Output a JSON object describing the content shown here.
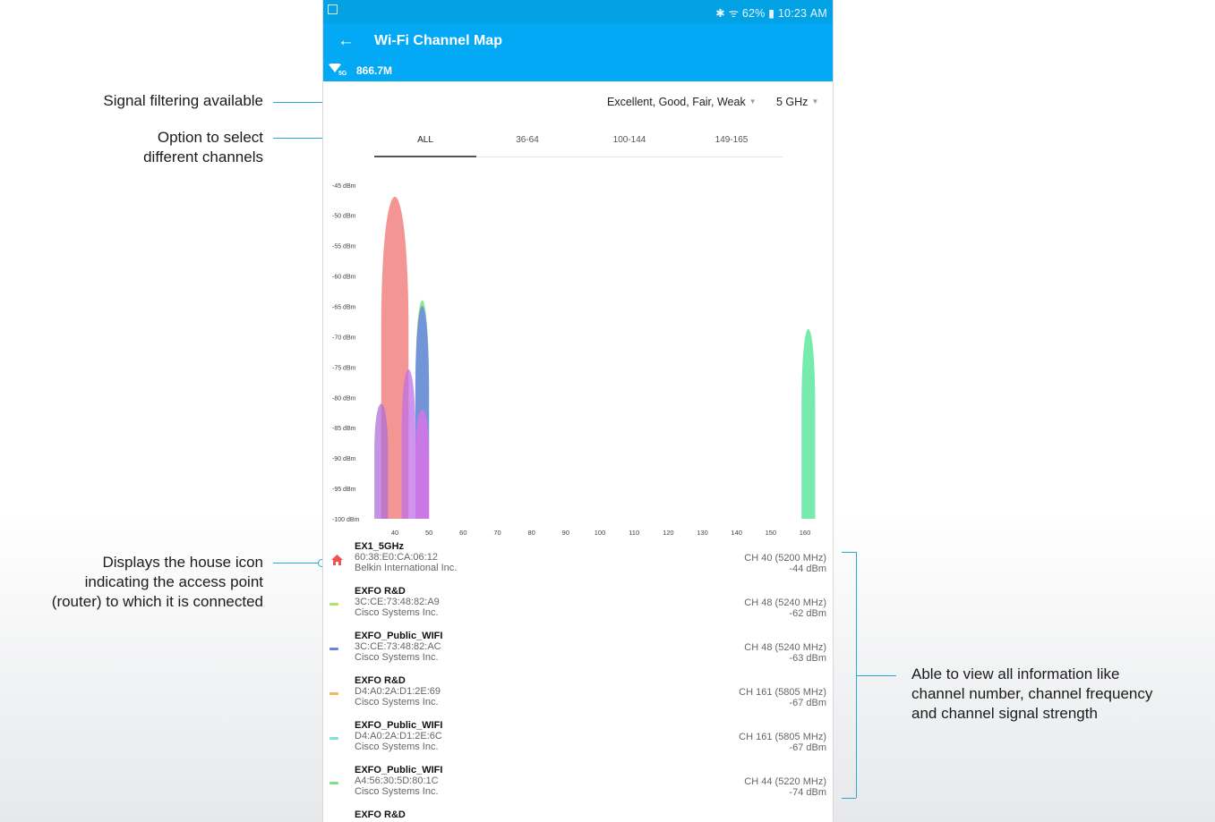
{
  "status_bar": {
    "right_text": "✱ ᯤ 62% ▮ 10:23 AM"
  },
  "app_bar": {
    "back_icon": "arrow-left-icon",
    "title": "Wi-Fi Channel Map"
  },
  "connection": {
    "band_badge": "5G",
    "speed": "866.7M"
  },
  "filters": {
    "signal": "Excellent, Good, Fair, Weak",
    "band": "5 GHz"
  },
  "tabs": [
    "ALL",
    "36-64",
    "100-144",
    "149-165"
  ],
  "active_tab": "ALL",
  "annotations": {
    "signal_filter": "Signal filtering available",
    "channel_select_1": "Option to select",
    "channel_select_2": "different channels",
    "house_1": "Displays the house icon",
    "house_2": "indicating the access point",
    "house_3": "(router) to which it is connected",
    "info_1": "Able to view all information like",
    "info_2": "channel number, channel frequency",
    "info_3": "and channel signal strength"
  },
  "chart_data": {
    "type": "area",
    "y_ticks": [
      "-45 dBm",
      "-50 dBm",
      "-55 dBm",
      "-60 dBm",
      "-65 dBm",
      "-70 dBm",
      "-75 dBm",
      "-80 dBm",
      "-85 dBm",
      "-90 dBm",
      "-95 dBm",
      "-100 dBm"
    ],
    "x_ticks": [
      "40",
      "50",
      "60",
      "70",
      "80",
      "90",
      "100",
      "110",
      "120",
      "130",
      "140",
      "150",
      "160"
    ],
    "ylim": [
      -100,
      -44
    ],
    "xlim": [
      33,
      165
    ],
    "grid": false,
    "series": [
      {
        "channel": 40,
        "peak_dbm": -44,
        "width_ch": 8,
        "color": "#f07a78",
        "opacity": 0.8
      },
      {
        "channel": 36,
        "peak_dbm": -80,
        "width_ch": 4,
        "color": "#b06fd8",
        "opacity": 0.75
      },
      {
        "channel": 48,
        "peak_dbm": -62,
        "width_ch": 4,
        "color": "#6fdc6f",
        "opacity": 0.75
      },
      {
        "channel": 48,
        "peak_dbm": -63,
        "width_ch": 4,
        "color": "#6f86e6",
        "opacity": 0.85
      },
      {
        "channel": 44,
        "peak_dbm": -74,
        "width_ch": 4,
        "color": "#c070e8",
        "opacity": 0.75
      },
      {
        "channel": 48,
        "peak_dbm": -81,
        "width_ch": 4,
        "color": "#e070e8",
        "opacity": 0.8
      },
      {
        "channel": 161,
        "peak_dbm": -67,
        "width_ch": 4,
        "color": "#5fe6a0",
        "opacity": 0.85
      }
    ]
  },
  "access_points": [
    {
      "name": "EX1_5GHz",
      "mac": "60:38:E0:CA:06:12",
      "vendor": "Belkin International Inc.",
      "channel": "CH 40 (5200 MHz)",
      "signal": "-44 dBm",
      "marker": "house-icon",
      "color": "#ef5350"
    },
    {
      "name": "EXFO R&D",
      "mac": "3C:CE:73:48:82:A9",
      "vendor": "Cisco Systems Inc.",
      "channel": "CH 48 (5240 MHz)",
      "signal": "-62 dBm",
      "marker": "swatch",
      "color": "#b2e06a"
    },
    {
      "name": "EXFO_Public_WIFI",
      "mac": "3C:CE:73:48:82:AC",
      "vendor": "Cisco Systems Inc.",
      "channel": "CH 48 (5240 MHz)",
      "signal": "-63 dBm",
      "marker": "swatch",
      "color": "#6f7fe8"
    },
    {
      "name": "EXFO R&D",
      "mac": "D4:A0:2A:D1:2E:69",
      "vendor": "Cisco Systems Inc.",
      "channel": "CH 161 (5805 MHz)",
      "signal": "-67 dBm",
      "marker": "swatch",
      "color": "#f2b65c"
    },
    {
      "name": "EXFO_Public_WIFI",
      "mac": "D4:A0:2A:D1:2E:6C",
      "vendor": "Cisco Systems Inc.",
      "channel": "CH 161 (5805 MHz)",
      "signal": "-67 dBm",
      "marker": "swatch",
      "color": "#7fe3d8"
    },
    {
      "name": "EXFO_Public_WIFI",
      "mac": "A4:56:30:5D:80:1C",
      "vendor": "Cisco Systems Inc.",
      "channel": "CH 44 (5220 MHz)",
      "signal": "-74 dBm",
      "marker": "swatch",
      "color": "#7de07a"
    },
    {
      "name": "EXFO R&D",
      "mac": "",
      "vendor": "",
      "channel": "",
      "signal": "",
      "marker": "none",
      "color": ""
    }
  ]
}
